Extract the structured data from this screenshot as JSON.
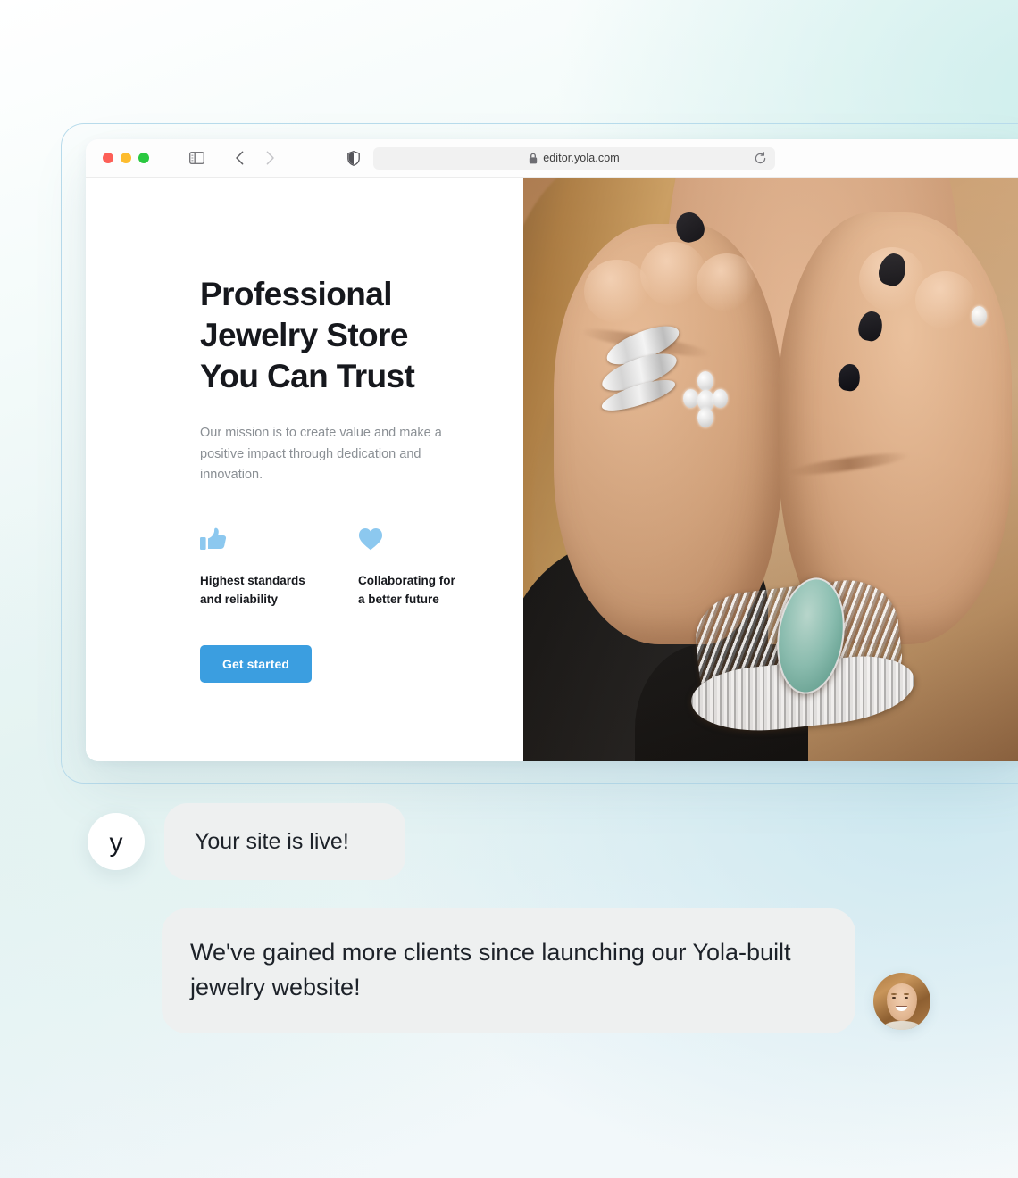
{
  "browser": {
    "window_controls": [
      "close",
      "minimize",
      "maximize"
    ],
    "sidebar_toggle_icon": "sidebar-icon",
    "back_icon": "chevron-left-icon",
    "forward_icon": "chevron-right-icon",
    "shield_icon": "shield-icon",
    "lock_icon": "lock-icon",
    "reload_icon": "reload-icon",
    "url": "editor.yola.com"
  },
  "hero": {
    "title": "Professional\nJewelry Store\nYou Can Trust",
    "subtitle": "Our mission is to create value and make a positive impact through dedication and innovation.",
    "features": [
      {
        "icon": "thumbs-up-icon",
        "label": "Highest standards\nand reliability"
      },
      {
        "icon": "heart-icon",
        "label": "Collaborating for\na better future"
      }
    ],
    "cta_label": "Get started",
    "image_alt": "Woman wearing diamond rings and a turquoise stone silver bracelet"
  },
  "chat": {
    "brand_avatar_letter": "y",
    "messages": [
      {
        "from": "yola",
        "text": "Your site is live!"
      },
      {
        "from": "customer",
        "text": "We've gained more clients since launching our Yola-built jewelry website!"
      }
    ],
    "customer_avatar_alt": "Smiling woman portrait"
  },
  "colors": {
    "accent_blue": "#3b9ee0",
    "feature_icon_blue": "#8cc8ef",
    "bubble_grey": "#eef0f0",
    "heading_dark": "#16181d",
    "body_grey": "#8a8f94",
    "frame_stroke": "#b9dcec"
  }
}
